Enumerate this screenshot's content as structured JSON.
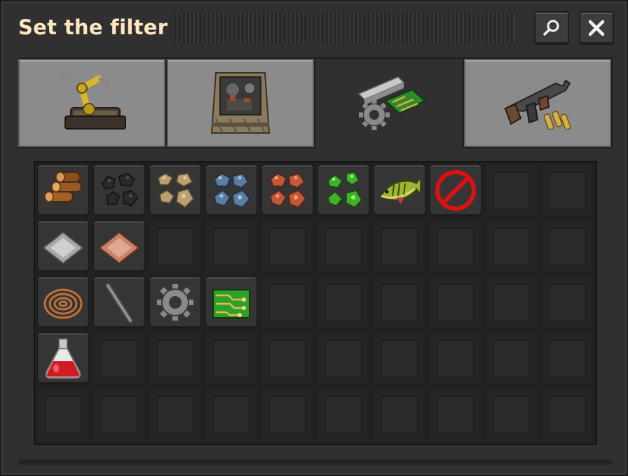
{
  "window": {
    "title": "Set the filter",
    "search_icon": "magnifier-icon",
    "close_icon": "close-x-icon"
  },
  "tabs": [
    {
      "name": "logistics",
      "icon": "inserter-icon",
      "selected": false
    },
    {
      "name": "production",
      "icon": "assembling-machine-icon",
      "selected": false
    },
    {
      "name": "intermediate-products",
      "icon": "gear-plate-circuit-icon",
      "selected": true
    },
    {
      "name": "combat",
      "icon": "submachine-gun-icon",
      "selected": false
    }
  ],
  "grid": {
    "columns": 10,
    "rows": 5,
    "items": [
      {
        "row": 0,
        "col": 0,
        "icon": "wood-icon"
      },
      {
        "row": 0,
        "col": 1,
        "icon": "coal-icon"
      },
      {
        "row": 0,
        "col": 2,
        "icon": "stone-icon"
      },
      {
        "row": 0,
        "col": 3,
        "icon": "iron-ore-icon"
      },
      {
        "row": 0,
        "col": 4,
        "icon": "copper-ore-icon"
      },
      {
        "row": 0,
        "col": 5,
        "icon": "uranium-ore-icon"
      },
      {
        "row": 0,
        "col": 6,
        "icon": "raw-fish-icon"
      },
      {
        "row": 0,
        "col": 7,
        "icon": "no-filter-icon"
      },
      {
        "row": 1,
        "col": 0,
        "icon": "iron-plate-icon"
      },
      {
        "row": 1,
        "col": 1,
        "icon": "copper-plate-icon"
      },
      {
        "row": 2,
        "col": 0,
        "icon": "copper-cable-icon"
      },
      {
        "row": 2,
        "col": 1,
        "icon": "iron-stick-icon"
      },
      {
        "row": 2,
        "col": 2,
        "icon": "iron-gear-wheel-icon"
      },
      {
        "row": 2,
        "col": 3,
        "icon": "electronic-circuit-icon"
      },
      {
        "row": 3,
        "col": 0,
        "icon": "automation-science-pack-icon"
      }
    ]
  },
  "colors": {
    "title_text": "#ffe6c0",
    "panel": "#313031",
    "tab_unselected": "#8b8b8b"
  }
}
